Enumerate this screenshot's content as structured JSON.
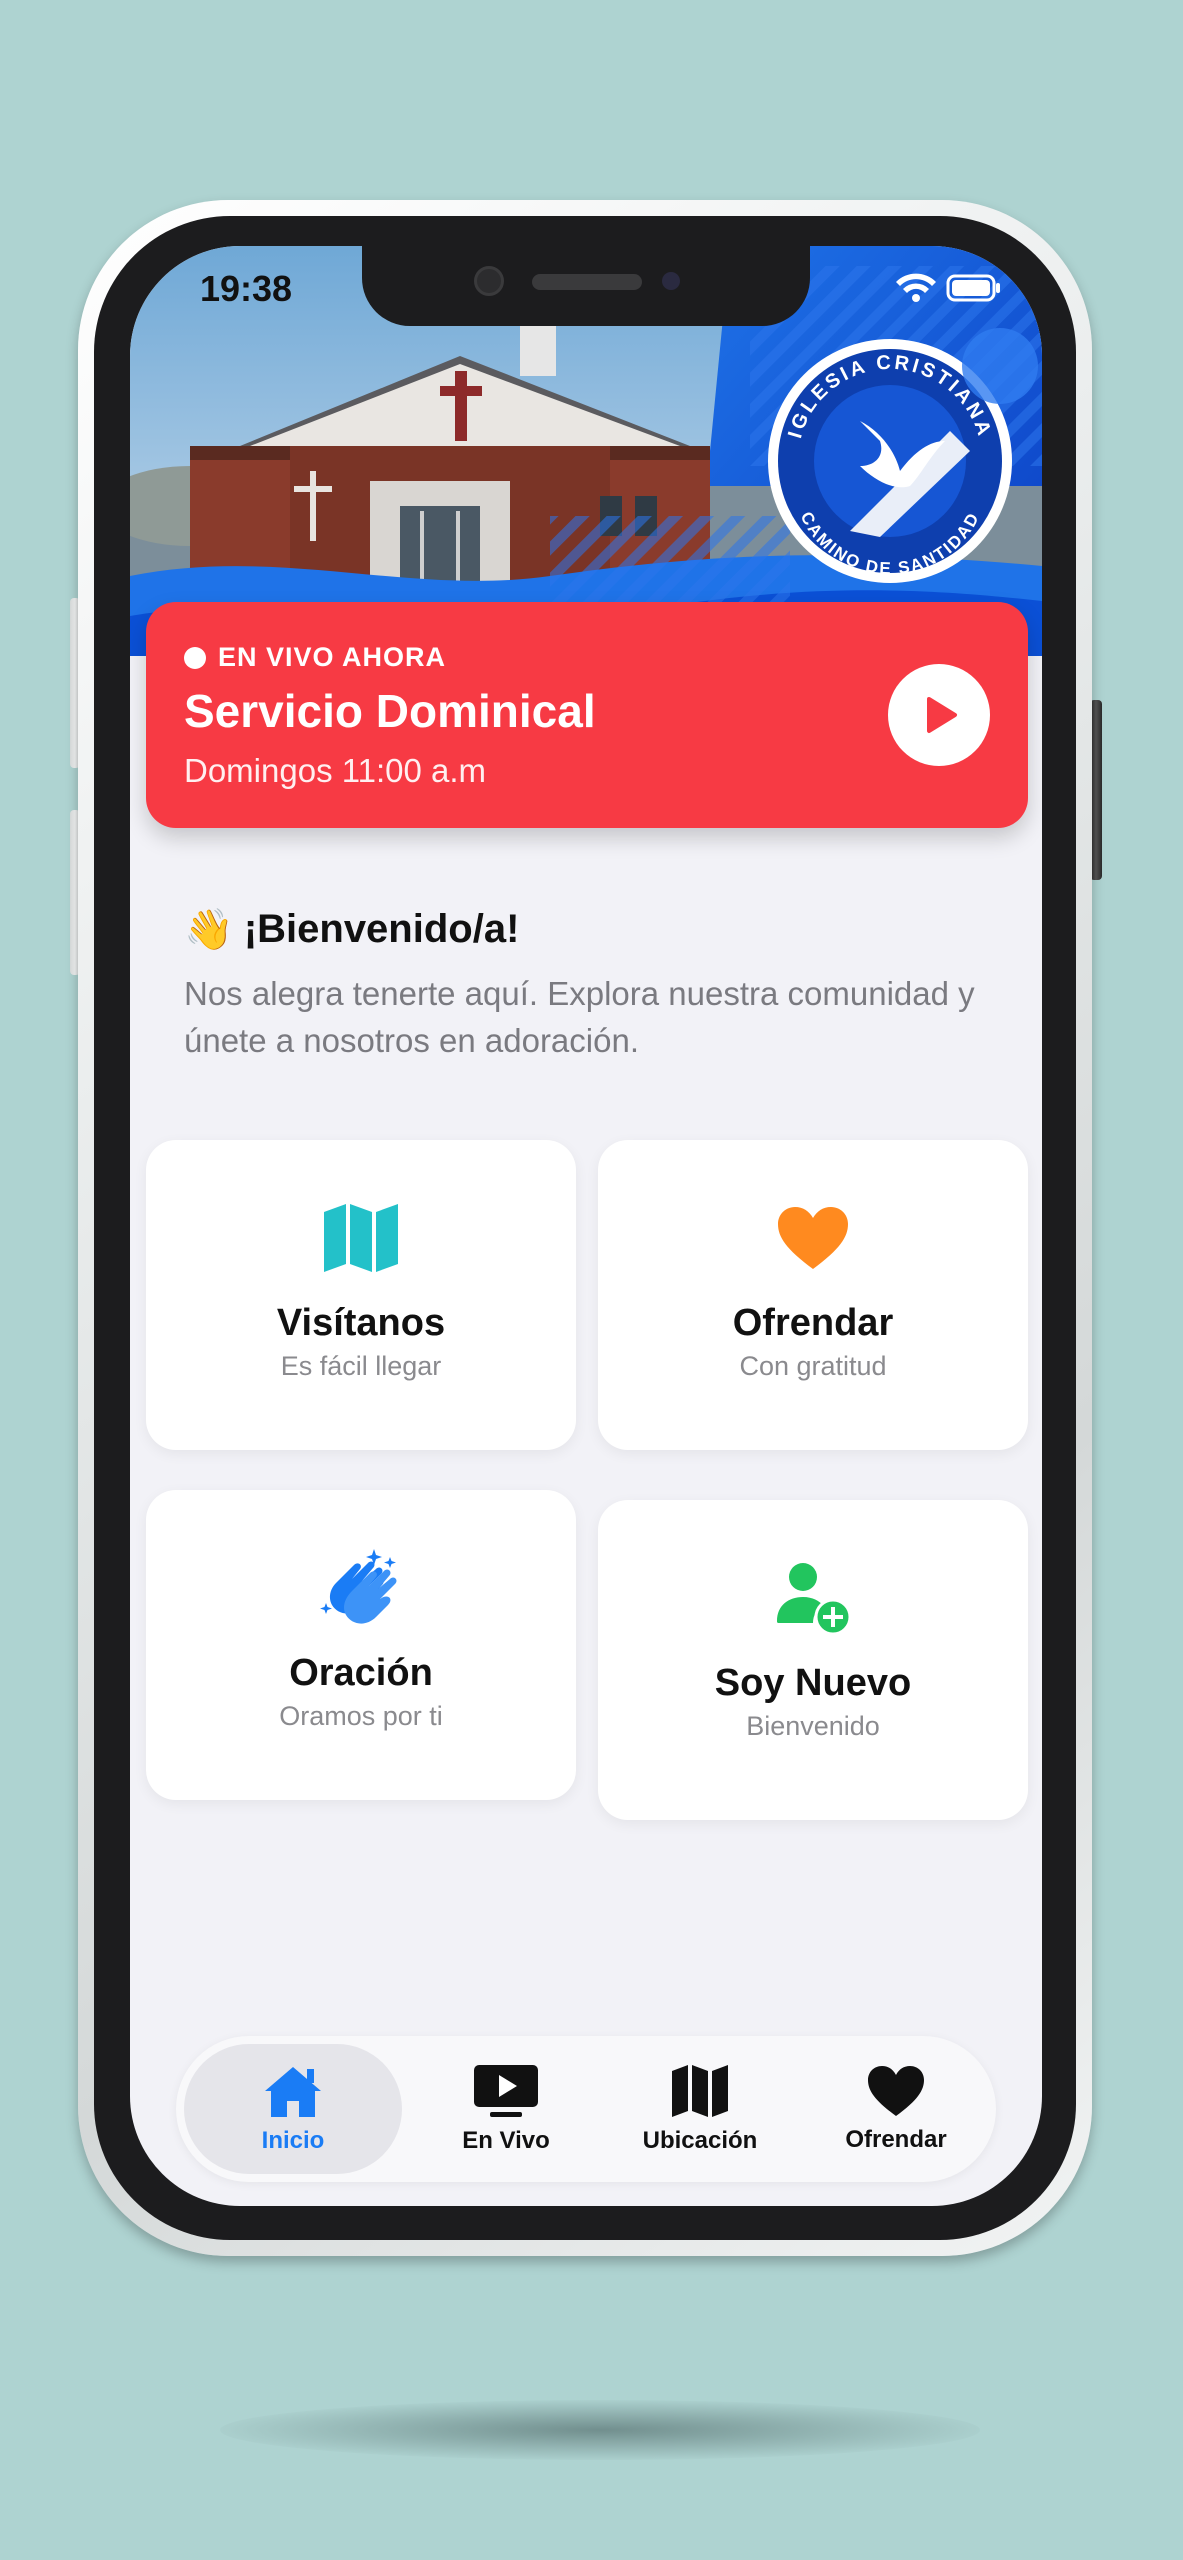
{
  "status_bar": {
    "time": "19:38"
  },
  "header": {
    "logo_text_top": "IGLESIA CRISTIANA",
    "logo_text_bottom": "CAMINO DE SANTIDAD"
  },
  "live_banner": {
    "tag": "EN VIVO AHORA",
    "title": "Servicio Dominical",
    "schedule": "Domingos 11:00 a.m"
  },
  "welcome": {
    "emoji": "👋",
    "title": "¡Bienvenido/a!",
    "message": "Nos alegra tenerte aquí. Explora nuestra comunidad y únete a nosotros en adoración."
  },
  "cards": [
    {
      "title": "Visítanos",
      "subtitle": "Es fácil llegar",
      "icon": "map-icon",
      "color": "#23c1c9"
    },
    {
      "title": "Ofrendar",
      "subtitle": "Con gratitud",
      "icon": "heart-icon",
      "color": "#ff8a1f"
    },
    {
      "title": "Oración",
      "subtitle": "Oramos por ti",
      "icon": "praying-hands-icon",
      "color": "#1a7cf5"
    },
    {
      "title": "Soy Nuevo",
      "subtitle": "Bienvenido",
      "icon": "add-person-icon",
      "color": "#22c55e"
    }
  ],
  "tabbar": {
    "items": [
      {
        "label": "Inicio",
        "icon": "home-icon",
        "active": true
      },
      {
        "label": "En Vivo",
        "icon": "tv-play-icon",
        "active": false
      },
      {
        "label": "Ubicación",
        "icon": "map-icon",
        "active": false
      },
      {
        "label": "Ofrendar",
        "icon": "heart-icon",
        "active": false
      }
    ]
  },
  "colors": {
    "background": "#aed3d1",
    "live_red": "#f73a44",
    "accent_blue": "#1a7cf5",
    "screen_bg": "#f2f2f7"
  }
}
